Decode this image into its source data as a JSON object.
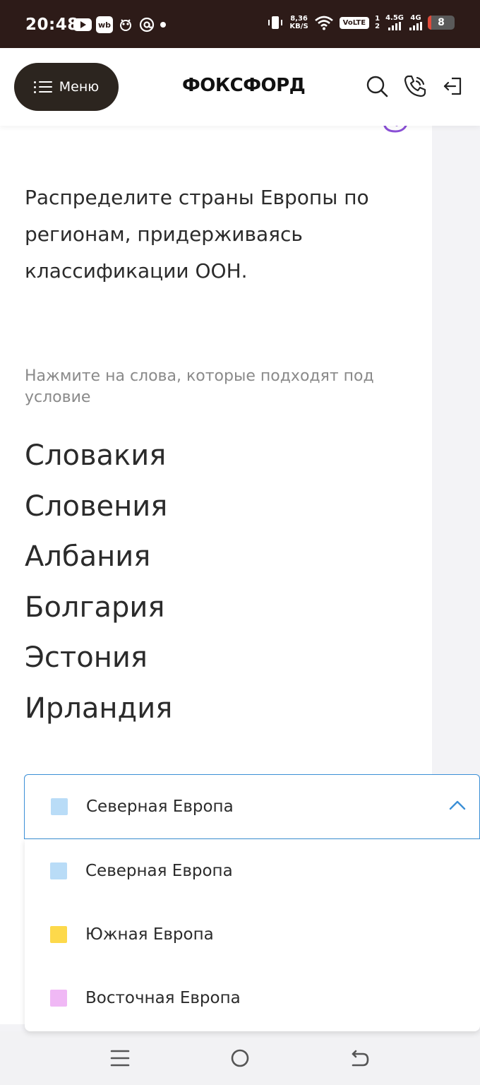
{
  "status_bar": {
    "time": "20:48",
    "app_icons": [
      "youtube-icon",
      "wb-icon",
      "bug-icon",
      "at-icon",
      "dot"
    ],
    "wb_label": "wb",
    "net_speed_top": "8,36",
    "net_speed_bottom": "KB/S",
    "volte": "VoLTE",
    "sim_slot_top": "1",
    "sim_slot_bottom": "2",
    "signal1_label": "4.5G",
    "signal2_label": "4G",
    "battery_level": "8",
    "battery_fraction": 0.12
  },
  "header": {
    "menu_label": "Меню",
    "logo": "ФОКСФОРД"
  },
  "task": {
    "question": "Распределите страны Европы по регионам, придерживаясь классификации ООН.",
    "instruction": "Нажмите на слова, которые подходят под условие",
    "words": [
      "Словакия",
      "Словения",
      "Албания",
      "Болгария",
      "Эстония",
      "Ирландия"
    ]
  },
  "dropdown": {
    "selected_label": "Северная Европа",
    "selected_color": "#b9dcf7",
    "options": [
      {
        "label": "Северная Европа",
        "color": "#b9dcf7"
      },
      {
        "label": "Южная Европа",
        "color": "#fdd94b"
      },
      {
        "label": "Восточная Европа",
        "color": "#f0b8f5"
      }
    ]
  },
  "colors": {
    "accent_blue": "#3b8fd6",
    "menu_bg": "#2c251f",
    "hint_purple": "#8a4fd6"
  }
}
